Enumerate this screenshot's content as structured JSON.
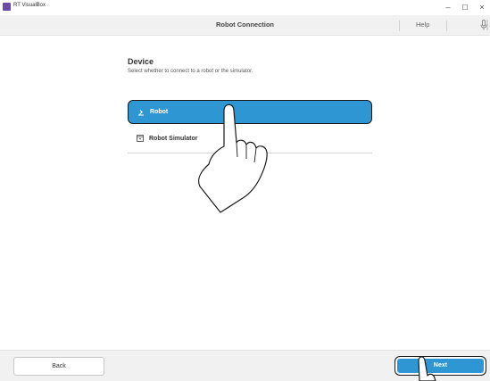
{
  "window": {
    "app_title": "RT VisualBox",
    "minimize_glyph": "–",
    "maximize_glyph": "☐",
    "close_glyph": "×"
  },
  "header": {
    "title": "Robot Connection",
    "help_label": "Help",
    "mic_icon": "microphone-icon"
  },
  "main": {
    "section_title": "Device",
    "section_description": "Select whether to connect to a robot or the simulator.",
    "options": [
      {
        "label": "Robot",
        "icon": "robot-arm-icon",
        "selected": true
      },
      {
        "label": "Robot Simulator",
        "icon": "simulator-icon",
        "selected": false
      }
    ]
  },
  "footer": {
    "back_label": "Back",
    "next_label": "Next"
  },
  "colors": {
    "accent": "#2e97d3",
    "header_bg": "#f1f1f1",
    "outline": "#1a1a1a"
  }
}
